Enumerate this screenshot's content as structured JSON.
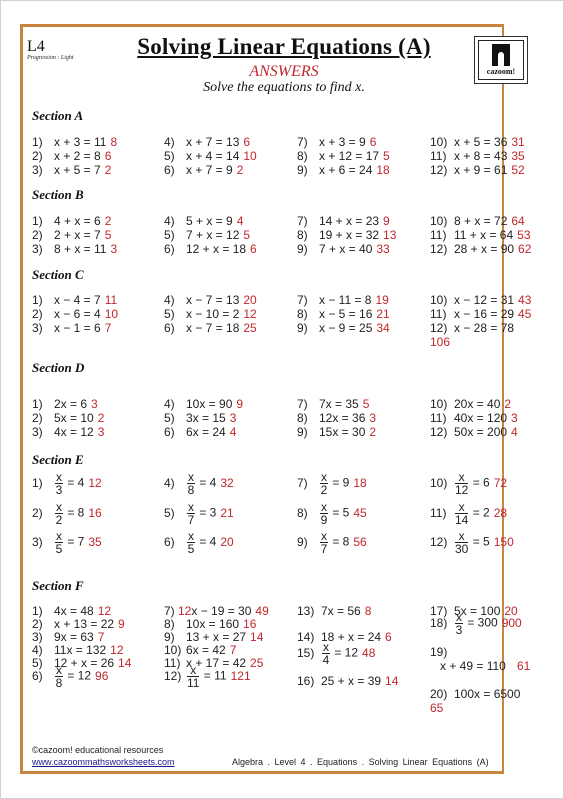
{
  "header": {
    "level": "L4",
    "progression": "Progression : Light",
    "title": "Solving Linear Equations (A)",
    "answers_label": "ANSWERS",
    "instructions": "Solve the equations to find x.",
    "logo_text": "cazoom!"
  },
  "sections": {
    "a": {
      "title": "Section A",
      "questions": [
        {
          "n": "1)",
          "eq": "x + 3 = 11",
          "ans": "8"
        },
        {
          "n": "2)",
          "eq": "x + 2 = 8",
          "ans": "6"
        },
        {
          "n": "3)",
          "eq": "x + 5 = 7",
          "ans": "2"
        },
        {
          "n": "4)",
          "eq": "x + 7 = 13",
          "ans": "6"
        },
        {
          "n": "5)",
          "eq": "x + 4 = 14",
          "ans": "10"
        },
        {
          "n": "6)",
          "eq": "x + 7 = 9",
          "ans": "2"
        },
        {
          "n": "7)",
          "eq": "x + 3 = 9",
          "ans": "6"
        },
        {
          "n": "8)",
          "eq": "x + 12 = 17",
          "ans": "5"
        },
        {
          "n": "9)",
          "eq": "x + 6 = 24",
          "ans": "18"
        },
        {
          "n": "10)",
          "eq": "x + 5 = 36",
          "ans": "31"
        },
        {
          "n": "11)",
          "eq": "x + 8 = 43",
          "ans": "35"
        },
        {
          "n": "12)",
          "eq": "x + 9 = 61",
          "ans": "52"
        }
      ]
    },
    "b": {
      "title": "Section B",
      "questions": [
        {
          "n": "1)",
          "eq": "4 + x = 6",
          "ans": "2"
        },
        {
          "n": "2)",
          "eq": "2 + x = 7",
          "ans": "5"
        },
        {
          "n": "3)",
          "eq": "8 + x = 11",
          "ans": "3"
        },
        {
          "n": "4)",
          "eq": "5 + x = 9",
          "ans": "4"
        },
        {
          "n": "5)",
          "eq": "7 + x = 12",
          "ans": "5"
        },
        {
          "n": "6)",
          "eq": "12 + x = 18",
          "ans": "6"
        },
        {
          "n": "7)",
          "eq": "14 + x = 23",
          "ans": "9"
        },
        {
          "n": "8)",
          "eq": "19 + x = 32",
          "ans": "13"
        },
        {
          "n": "9)",
          "eq": "7 + x = 40",
          "ans": "33"
        },
        {
          "n": "10)",
          "eq": "8 + x = 72",
          "ans": "64"
        },
        {
          "n": "11)",
          "eq": "11 + x = 64",
          "ans": "53"
        },
        {
          "n": "12)",
          "eq": "28 + x = 90",
          "ans": "62"
        }
      ]
    },
    "c": {
      "title": "Section C",
      "questions": [
        {
          "n": "1)",
          "eq": "x − 4 = 7",
          "ans": "11"
        },
        {
          "n": "2)",
          "eq": "x − 6 = 4",
          "ans": "10"
        },
        {
          "n": "3)",
          "eq": "x − 1 = 6",
          "ans": "7"
        },
        {
          "n": "4)",
          "eq": "x − 7 = 13",
          "ans": "20"
        },
        {
          "n": "5)",
          "eq": "x − 10 = 2",
          "ans": "12"
        },
        {
          "n": "6)",
          "eq": "x − 7 = 18",
          "ans": "25"
        },
        {
          "n": "7)",
          "eq": "x − 11 = 8",
          "ans": "19"
        },
        {
          "n": "8)",
          "eq": "x − 5 = 16",
          "ans": "21"
        },
        {
          "n": "9)",
          "eq": "x − 9 = 25",
          "ans": "34"
        },
        {
          "n": "10)",
          "eq": "x − 12 = 31",
          "ans": "43"
        },
        {
          "n": "11)",
          "eq": "x − 16 = 29",
          "ans": "45"
        },
        {
          "n": "12)",
          "eq": "x − 28 = 78",
          "ans": "106"
        }
      ]
    },
    "d": {
      "title": "Section D",
      "questions": [
        {
          "n": "1)",
          "eq": "2x = 6",
          "ans": "3"
        },
        {
          "n": "2)",
          "eq": "5x = 10",
          "ans": "2"
        },
        {
          "n": "3)",
          "eq": "4x = 12",
          "ans": "3"
        },
        {
          "n": "4)",
          "eq": "10x = 90",
          "ans": "9"
        },
        {
          "n": "5)",
          "eq": "3x = 15",
          "ans": "3"
        },
        {
          "n": "6)",
          "eq": "6x = 24",
          "ans": "4"
        },
        {
          "n": "7)",
          "eq": "7x = 35",
          "ans": "5"
        },
        {
          "n": "8)",
          "eq": "12x = 36",
          "ans": "3"
        },
        {
          "n": "9)",
          "eq": "15x = 30",
          "ans": "2"
        },
        {
          "n": "10)",
          "eq": "20x = 40",
          "ans": "2"
        },
        {
          "n": "11)",
          "eq": "40x = 120",
          "ans": "3"
        },
        {
          "n": "12)",
          "eq": "50x = 200",
          "ans": "4"
        }
      ]
    },
    "e": {
      "title": "Section E",
      "questions": [
        {
          "n": "1)",
          "num": "x",
          "den": "3",
          "rhs": "= 4",
          "ans": "12"
        },
        {
          "n": "2)",
          "num": "x",
          "den": "2",
          "rhs": "= 8",
          "ans": "16"
        },
        {
          "n": "3)",
          "num": "x",
          "den": "5",
          "rhs": "= 7",
          "ans": "35"
        },
        {
          "n": "4)",
          "num": "x",
          "den": "8",
          "rhs": "= 4",
          "ans": "32"
        },
        {
          "n": "5)",
          "num": "x",
          "den": "7",
          "rhs": "= 3",
          "ans": "21"
        },
        {
          "n": "6)",
          "num": "x",
          "den": "5",
          "rhs": "= 4",
          "ans": "20"
        },
        {
          "n": "7)",
          "num": "x",
          "den": "2",
          "rhs": "= 9",
          "ans": "18"
        },
        {
          "n": "8)",
          "num": "x",
          "den": "9",
          "rhs": "= 5",
          "ans": "45"
        },
        {
          "n": "9)",
          "num": "x",
          "den": "7",
          "rhs": "= 8",
          "ans": "56"
        },
        {
          "n": "10)",
          "num": "x",
          "den": "12",
          "rhs": "= 6",
          "ans": "72"
        },
        {
          "n": "11)",
          "num": "x",
          "den": "14",
          "rhs": "= 2",
          "ans": "28"
        },
        {
          "n": "12)",
          "num": "x",
          "den": "30",
          "rhs": "= 5",
          "ans": "150"
        }
      ]
    },
    "f": {
      "title": "Section F",
      "questions": [
        {
          "n": "1)",
          "eq": "4x = 48",
          "ans": "12"
        },
        {
          "n": "2)",
          "eq": "x + 13 = 22",
          "ans": "9"
        },
        {
          "n": "3)",
          "eq": "9x = 63",
          "ans": "7"
        },
        {
          "n": "4)",
          "eq": "11x = 132",
          "ans": "12"
        },
        {
          "n": "5)",
          "eq": "12 + x = 26",
          "ans": "14"
        },
        {
          "n": "6)",
          "num": "x",
          "den": "8",
          "rhs": "= 12",
          "ans": "96"
        },
        {
          "n": "7)",
          "prefix": "12",
          "eq": "x − 19 = 30",
          "ans": "49"
        },
        {
          "n": "8)",
          "eq": "10x = 160",
          "ans": "16"
        },
        {
          "n": "9)",
          "eq": "13 + x = 27",
          "ans": "14"
        },
        {
          "n": "10)",
          "eq": "6x = 42",
          "ans": "7"
        },
        {
          "n": "11)",
          "eq": "x + 17 = 42",
          "ans": "25"
        },
        {
          "n": "12)",
          "num": "x",
          "den": "11",
          "rhs": "= 11",
          "ans": "121"
        },
        {
          "n": "13)",
          "eq": "7x = 56",
          "ans": "8"
        },
        {
          "n": "14)",
          "eq": "18 + x = 24",
          "ans": "6"
        },
        {
          "n": "15)",
          "num": "x",
          "den": "4",
          "rhs": "= 12",
          "ans": "48"
        },
        {
          "n": "16)",
          "eq": "25 + x = 39",
          "ans": "14"
        },
        {
          "n": "17)",
          "eq": "5x = 100",
          "ans": "20"
        },
        {
          "n": "18)",
          "num": "x",
          "den": "3",
          "rhs": "= 300",
          "ans": "900"
        },
        {
          "n": "19)",
          "eq": "x + 49 = 110",
          "ans": "61"
        },
        {
          "n": "20)",
          "eq": "100x = 6500",
          "ans": "65"
        }
      ]
    }
  },
  "footer": {
    "copyright": "©cazoom! educational resources",
    "link": "www.cazoommathsworksheets.com",
    "meta": "Algebra  .  Level 4  .  Equations   .  Solving Linear Equations (A)"
  },
  "colors": {
    "border": "#c8853f",
    "answer": "#c0272d"
  }
}
